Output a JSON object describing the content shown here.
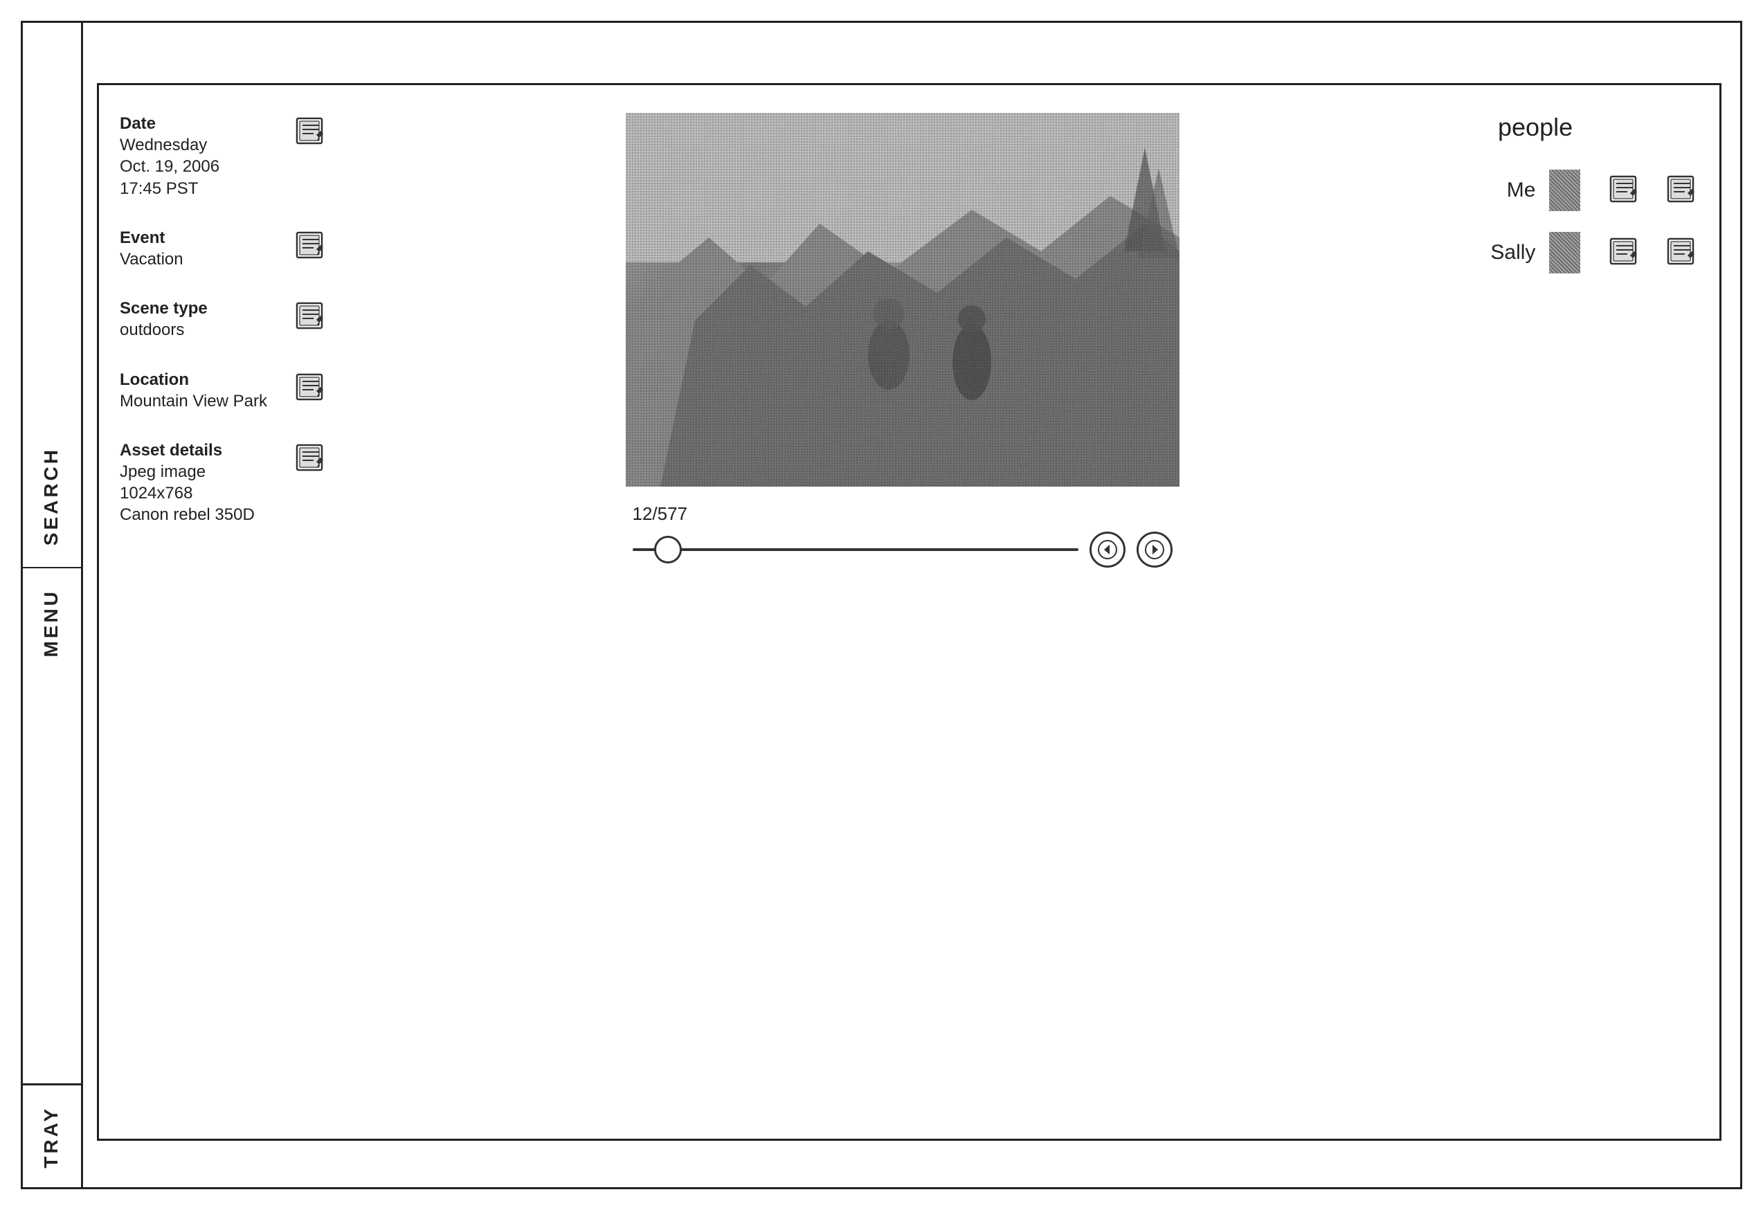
{
  "sidebar": {
    "search_label": "SEARCH",
    "menu_label": "MENU",
    "tray_label": "TRAY"
  },
  "info": {
    "date_label": "Date",
    "date_value": "Wednesday\nOct. 19, 2006\n17:45 PST",
    "date_day": "Wednesday",
    "date_full": "Oct. 19, 2006",
    "date_time": "17:45 PST",
    "event_label": "Event",
    "event_value": "Vacation",
    "scene_label": "Scene type",
    "scene_value": "outdoors",
    "location_label": "Location",
    "location_value": "Mountain View Park",
    "asset_label": "Asset details",
    "asset_type": "Jpeg image",
    "asset_size": "1024x768",
    "asset_camera": "Canon rebel 350D"
  },
  "slider": {
    "counter": "12/577"
  },
  "people": {
    "title": "people",
    "persons": [
      {
        "name": "Me"
      },
      {
        "name": "Sally"
      }
    ]
  },
  "icons": {
    "edit": "✏",
    "prev": "◀",
    "next": "▶"
  }
}
